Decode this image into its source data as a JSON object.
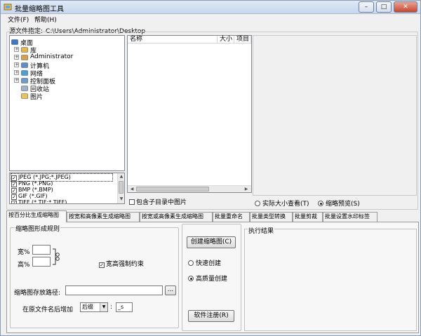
{
  "window": {
    "title": "批量缩略图工具",
    "minimize": "–",
    "maximize": "□",
    "close": "✕"
  },
  "menu": {
    "file": "文件(F)",
    "help": "帮助(H)"
  },
  "source": {
    "label": "源文件指定:",
    "path": "C:\\Users\\Administrator\\Desktop"
  },
  "tree": [
    {
      "label": "桌面",
      "icon": "desktop-icon",
      "expandable": false,
      "level": 0
    },
    {
      "label": "库",
      "icon": "library-icon",
      "expandable": true,
      "level": 1
    },
    {
      "label": "Administrator",
      "icon": "user-folder-icon",
      "expandable": true,
      "level": 1
    },
    {
      "label": "计算机",
      "icon": "computer-icon",
      "expandable": true,
      "level": 1
    },
    {
      "label": "网络",
      "icon": "network-icon",
      "expandable": true,
      "level": 1
    },
    {
      "label": "控制面板",
      "icon": "control-panel-icon",
      "expandable": true,
      "level": 1
    },
    {
      "label": "回收站",
      "icon": "recycle-bin-icon",
      "expandable": false,
      "level": 1
    },
    {
      "label": "图片",
      "icon": "folder-icon",
      "expandable": false,
      "level": 1
    }
  ],
  "filetypes": [
    {
      "label": "JPEG (*.JPG;*.JPEG)",
      "checked": true
    },
    {
      "label": "PNG (*.PNG)",
      "checked": true
    },
    {
      "label": "BMP (*.BMP)",
      "checked": true
    },
    {
      "label": "GIF (*.GIF)",
      "checked": true
    },
    {
      "label": "TIFF (*.TIF;*.TIFF)",
      "checked": true
    }
  ],
  "filelist": {
    "col_name": "名称",
    "col_size": "大小",
    "col_item": "项目",
    "include_subdirs": "包含子目录中图片"
  },
  "preview": {
    "actual_size": "实际大小查看(T)",
    "thumbnail_preview": "缩略预览(S)",
    "selected": "thumbnail_preview"
  },
  "tabs": [
    "按百分比生成缩略图",
    "按宽和高像素生成缩略图",
    "按宽或高像素生成缩略图",
    "批量重命名",
    "批量类型转换",
    "批量剪裁",
    "批量设置水印标签"
  ],
  "rules": {
    "legend": "缩略图形成规则",
    "width_label": "宽%",
    "height_label": "高%",
    "width_value": "",
    "height_value": "",
    "force_aspect": "宽高强制约束",
    "force_aspect_checked": true,
    "save_path_label": "缩略图存放路径:",
    "save_path_value": "",
    "browse": "...",
    "suffix_label": "在原文件名后增加",
    "suffix_mode": "后缀",
    "suffix_value": "_s"
  },
  "actions": {
    "create": "创建缩略图(C)",
    "fast": "快速创建",
    "high_quality": "高质量创建",
    "quality_selected": "high_quality",
    "register": "软件注册(R)"
  },
  "results": {
    "label": "执行结果"
  }
}
